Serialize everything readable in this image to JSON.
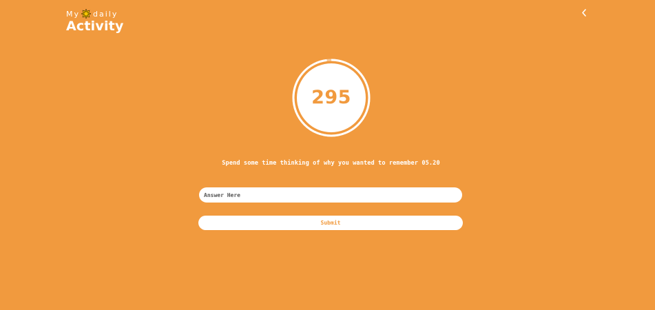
{
  "header": {
    "logo_top_left": "My",
    "logo_top_right": "daily",
    "logo_bottom": "Activity",
    "logo_icon": "sun-icon",
    "back_icon": "chevron-left-icon"
  },
  "timer": {
    "value": "295",
    "progress": 0.98
  },
  "prompt": {
    "text": "Spend some time thinking of why you wanted to remember 05.20"
  },
  "form": {
    "answer_placeholder": "Answer Here",
    "answer_value": "",
    "submit_label": "Submit"
  },
  "colors": {
    "background": "#f19a3e",
    "foreground": "#ffffff",
    "sun": "#f5c400"
  }
}
